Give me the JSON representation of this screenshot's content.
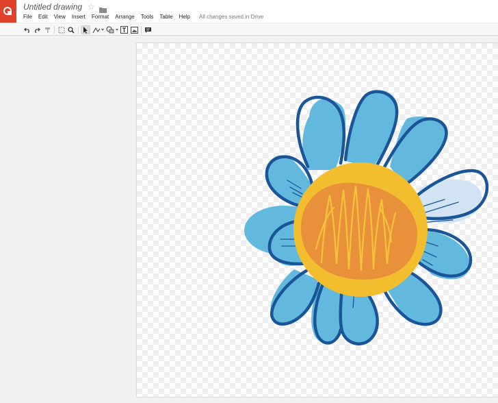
{
  "app": {
    "title": "Untitled drawing",
    "save_status": "All changes saved in Drive",
    "brand_color": "#e0412a"
  },
  "menu": {
    "items": [
      "File",
      "Edit",
      "View",
      "Insert",
      "Format",
      "Arrange",
      "Tools",
      "Table",
      "Help"
    ]
  },
  "toolbar": {
    "tools": [
      "undo-icon",
      "redo-icon",
      "paint-format-icon",
      "zoom-fit-icon",
      "zoom-icon",
      "select-icon",
      "line-icon",
      "shape-icon",
      "text-box-icon",
      "image-icon",
      "comment-icon"
    ]
  },
  "canvas": {
    "content": "flower-drawing",
    "colors": {
      "petal_fill": "#63b9dd",
      "petal_outline": "#1a5697",
      "light_petal": "#d2e4f3",
      "center_ring": "#f2bd2f",
      "center_fill": "#e8913a",
      "scribble": "#f5c33a"
    }
  }
}
